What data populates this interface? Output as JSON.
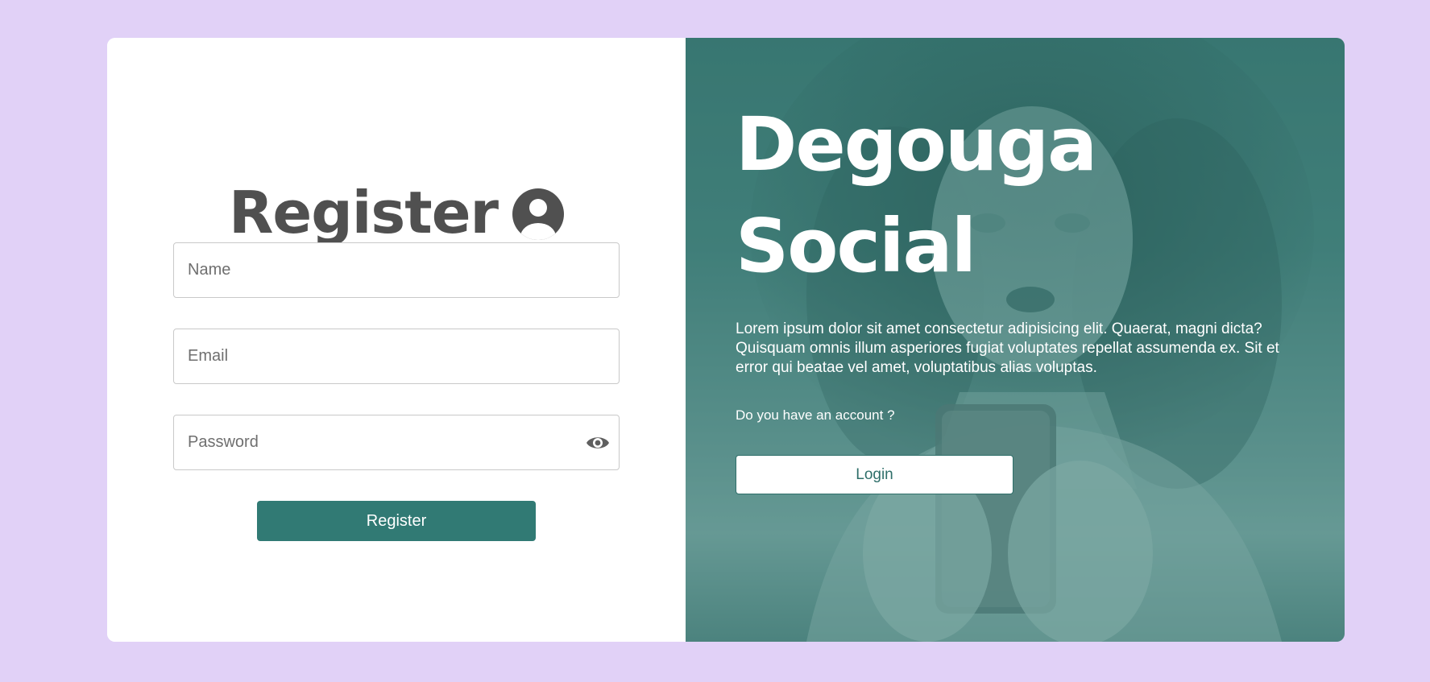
{
  "register_form": {
    "title": "Register",
    "title_icon": "user-circle-icon",
    "name_placeholder": "Name",
    "email_placeholder": "Email",
    "password_placeholder": "Password",
    "password_toggle_icon": "eye-icon",
    "submit_label": "Register"
  },
  "hero": {
    "brand_line1": "Degouga",
    "brand_line2": "Social",
    "description": "Lorem ipsum dolor sit amet consectetur adipisicing elit. Quaerat, magni dicta? Quisquam omnis illum asperiores fugiat voluptates repellat assumenda ex. Sit et error qui beatae vel amet, voluptatibus alias voluptas.",
    "question": "Do you have an account ?",
    "login_label": "Login",
    "background_image": "woman-holding-phone-photo"
  },
  "colors": {
    "page_background": "#e1d1f7",
    "accent": "#317a74",
    "title_text": "#505050",
    "overlay": "#2b6e68"
  }
}
